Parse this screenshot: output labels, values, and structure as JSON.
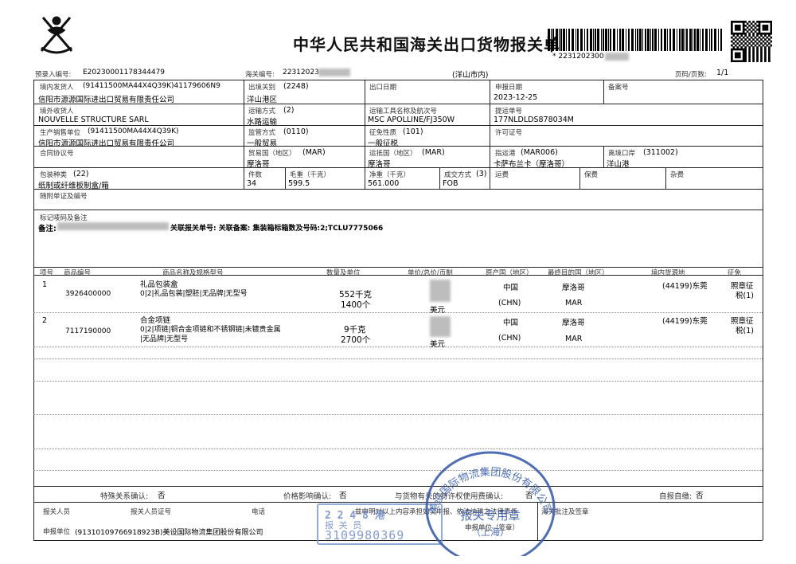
{
  "header": {
    "title": "中华人民共和国海关出口货物报关单",
    "barcode_text": "* 2231202300",
    "prerecord_label": "预录入编号:",
    "prerecord_no": "E20230001178344479",
    "customs_no_label": "海关编号:",
    "customs_no": "22312023",
    "port_region": "(洋山市内)",
    "page_label": "页码/页数:",
    "page_value": "1/1"
  },
  "row1": {
    "shipper_label": "境内发货人",
    "shipper_code": "(91411500MA44X4Q39K)41179606N9",
    "shipper_name": "信阳市源源国际进出口贸易有限责任公司",
    "exit_customs_label": "出境关别",
    "exit_customs_code": "(2248)",
    "exit_customs_name": "洋山港区",
    "export_date_label": "出口日期",
    "declare_date_label": "申报日期",
    "declare_date": "2023-12-25",
    "record_no_label": "备案号"
  },
  "row2": {
    "consignee_label": "境外收货人",
    "consignee_name": "NOUVELLE STRUCTURE SARL",
    "transport_label": "运输方式",
    "transport_code": "(2)",
    "transport_name": "水路运输",
    "vessel_label": "运输工具名称及航次号",
    "vessel_name": "MSC APOLLINE/FJ350W",
    "bl_label": "提运单号",
    "bl_no": "177NLDLDS878034M"
  },
  "row3": {
    "producer_label": "生产销售单位",
    "producer_code": "(91411500MA44X4Q39K)",
    "producer_name": "信阳市源源国际进出口贸易有限责任公司",
    "supervision_label": "监管方式",
    "supervision_code": "(0110)",
    "supervision_name": "一般贸易",
    "levy_label": "征免性质",
    "levy_code": "(101)",
    "levy_name": "一般征税",
    "license_label": "许可证号"
  },
  "row4": {
    "contract_label": "合同协议号",
    "trade_country_label": "贸易国（地区）",
    "trade_country_code": "(MAR)",
    "trade_country_name": "摩洛哥",
    "dest_country_label": "运抵国（地区）",
    "dest_country_code": "(MAR)",
    "dest_country_name": "摩洛哥",
    "dest_port_label": "指运港",
    "dest_port_code": "(MAR006)",
    "dest_port_name": "卡萨布兰卡（摩洛哥）",
    "exit_port_label": "离境口岸",
    "exit_port_code": "(311002)",
    "exit_port_name": "洋山港"
  },
  "row5": {
    "package_label": "包装种类",
    "package_code": "(22)",
    "package_name": "纸制或纤维板制盒/箱",
    "pieces_label": "件数",
    "pieces": "34",
    "gross_label": "毛重（千克）",
    "gross": "599.5",
    "net_label": "净重（千克）",
    "net": "561.000",
    "terms_label": "成交方式",
    "terms_code": "(3)",
    "terms_name": "FOB",
    "freight_label": "运费",
    "insurance_label": "保费",
    "misc_label": "杂费"
  },
  "docs_label": "随附单证及编号",
  "marks": {
    "label": "标记唛码及备注",
    "prefix": "备注:",
    "text": "关联报关单号: 关联备案: 集装箱标箱数及号码:2;TCLU7775066"
  },
  "goods_headers": {
    "seq": "项号",
    "code": "商品编号",
    "name": "商品名称及规格型号",
    "qty": "数量及单位",
    "price": "单价/总价/币制",
    "origin": "原产国（地区）",
    "final_dest": "最终目的国（地区）",
    "source": "境内货源地",
    "levy": "征免"
  },
  "goods": [
    {
      "seq": "1",
      "code": "3926400000",
      "name": "礼品包装盒",
      "spec": "0|2|礼品包装|塑胚|无品牌|无型号",
      "spec2": "",
      "qty1": "552千克",
      "qty2": "1400个",
      "currency": "美元",
      "origin": "中国",
      "origin_code": "(CHN)",
      "dest": "摩洛哥",
      "dest_code": "MAR",
      "source": "(44199)东莞",
      "levy1": "照章征",
      "levy2": "税(1)"
    },
    {
      "seq": "2",
      "code": "7117190000",
      "name": "合金项链",
      "spec": "0|2|项链|铜合金项链和不锈钢链|未镀贵金属",
      "spec2": "|无品牌|无型号",
      "qty1": "9千克",
      "qty2": "2700个",
      "currency": "美元",
      "origin": "中国",
      "origin_code": "(CHN)",
      "dest": "摩洛哥",
      "dest_code": "MAR",
      "source": "(44199)东莞",
      "levy1": "照章征",
      "levy2": "税(1)"
    }
  ],
  "footer": {
    "special_label": "特殊关系确认:",
    "special_value": "否",
    "price_label": "价格影响确认:",
    "price_value": "否",
    "royalty_label": "与货物有关的特许权使用费确认:",
    "royalty_value": "否",
    "self_label": "自报自缴:",
    "self_value": "否",
    "declarant_label": "报关人员",
    "declarant_cert_label": "报关人员证号",
    "phone_label": "电话",
    "statement": "兹申明对以上内容承担如实申报、依法纳税之法律责任",
    "customs_note_label": "海关批注及签章",
    "unit_label": "申报单位",
    "unit_value": "(91310109766918923B)美设国际物流集团股份有限公司",
    "unit_sign_label": "申报单位（签章）"
  },
  "stamps": {
    "round_text": "美设国际物流集团股份有限公司",
    "round_center1": "报关专用章",
    "round_center2": "（上海）",
    "rect_line1": "2 2 4 8 港",
    "rect_line2": "报 关 员",
    "rect_line3": "3109980369"
  },
  "colors": {
    "stamp_blue": "#3a5fb0",
    "stamp_blue_light": "#7f9bd6"
  }
}
